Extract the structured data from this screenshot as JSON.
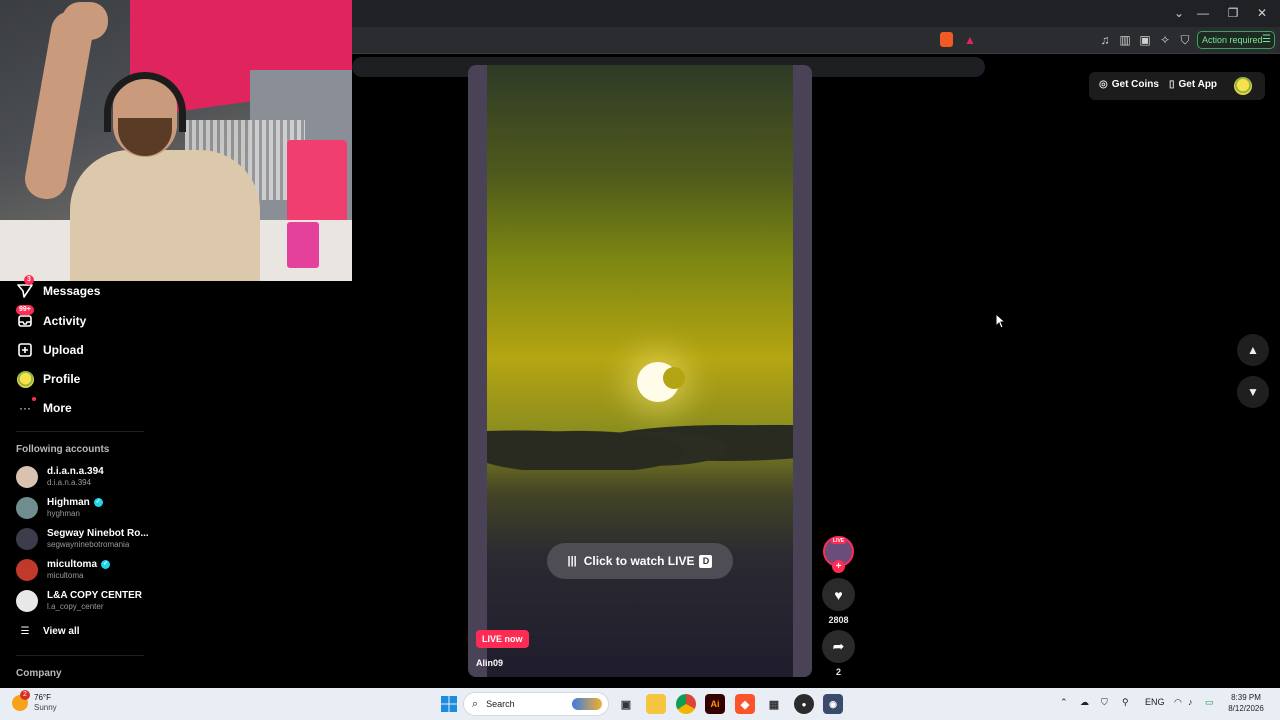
{
  "browser": {
    "action_required": "Action required",
    "window_controls": [
      "⌄",
      "—",
      "❐",
      "✕"
    ]
  },
  "sidebar": {
    "nav": [
      {
        "label": "Messages",
        "icon": "paper-plane-icon",
        "badge": "3"
      },
      {
        "label": "Activity",
        "icon": "inbox-icon",
        "badge": "99+"
      },
      {
        "label": "Upload",
        "icon": "plus-square-icon"
      },
      {
        "label": "Profile",
        "icon": "profile-avatar"
      },
      {
        "label": "More",
        "icon": "more-dots-icon"
      }
    ],
    "following_title": "Following accounts",
    "accounts": [
      {
        "name": "d.i.a.n.a.394",
        "handle": "d.i.a.n.a.394",
        "verified": false,
        "color": "#d9c2b0"
      },
      {
        "name": "Highman",
        "handle": "hyghman",
        "verified": true,
        "color": "#6f8c8f"
      },
      {
        "name": "Segway Ninebot Ro...",
        "handle": "segwayninebotromania",
        "verified": false,
        "color": "#3c3c4a"
      },
      {
        "name": "micultoma",
        "handle": "micultoma",
        "verified": true,
        "color": "#c0392b"
      },
      {
        "name": "L&A COPY CENTER",
        "handle": "l.a_copy_center",
        "verified": false,
        "color": "#e8e8e8"
      }
    ],
    "view_all": "View all",
    "company": "Company"
  },
  "video": {
    "watch_live": "Click to watch LIVE",
    "watch_key": "D",
    "live_now": "LIVE now",
    "author": "Alin09"
  },
  "actions": {
    "live_tag": "LIVE",
    "likes": "2808",
    "shares": "2"
  },
  "top_right": {
    "get_coins": "Get Coins",
    "get_app": "Get App"
  },
  "taskbar": {
    "temp": "76°F",
    "condition": "Sunny",
    "weather_badge": "2",
    "search_placeholder": "Search",
    "lang": "ENG",
    "time": "8:39 PM",
    "date": "8/12/2026"
  },
  "colors": {
    "accent": "#fe2c55",
    "verified": "#20d5ec",
    "action_green": "#3aa55d"
  }
}
